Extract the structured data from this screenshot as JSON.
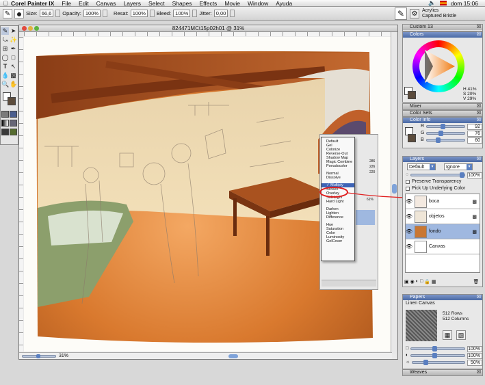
{
  "menubar": {
    "app_name": "Corel Painter IX",
    "items": [
      "File",
      "Edit",
      "Canvas",
      "Layers",
      "Select",
      "Shapes",
      "Effects",
      "Movie",
      "Window",
      "Ayuda"
    ],
    "clock": "dom 15:06"
  },
  "property_bar": {
    "size_label": "Size:",
    "size_value": "66,6",
    "opacity_label": "Opacity:",
    "opacity_value": "100%",
    "resat_label": "Resat:",
    "resat_value": "100%",
    "bleed_label": "Bleed:",
    "bleed_value": "100%",
    "jitter_label": "Jitter:",
    "jitter_value": "0,00",
    "brush_category": "Acrylics",
    "brush_variant": "Captured Bristle"
  },
  "document": {
    "title": "824471MCt15p02h01 @ 31%",
    "zoom": "31%"
  },
  "panels": {
    "custom_title": "Custom 13",
    "colors_title": "Colors",
    "hsv": [
      "H 41%",
      "S 20%",
      "V 29%"
    ],
    "mixer_title": "Mixer",
    "color_sets_title": "Color Sets",
    "color_info_title": "Color Info",
    "rgb": [
      {
        "label": "R",
        "value": "92",
        "fill": 0.36
      },
      {
        "label": "G",
        "value": "76",
        "fill": 0.3
      },
      {
        "label": "B",
        "value": "60",
        "fill": 0.24
      }
    ],
    "layers_title": "Layers",
    "composite_method": "Default",
    "composite_depth": "Ignore",
    "layer_opacity": "100%",
    "preserve_transparency": "Preserve Transparency",
    "pick_up_underlying": "Pick Up Underlying Color",
    "layer_names": [
      "boca",
      "objetos",
      "fondo",
      "Canvas"
    ],
    "papers_title": "Papers",
    "paper_name": "Linen Canvas",
    "paper_rows": "512 Rows",
    "paper_columns": "512 Columns",
    "paper_values": [
      "100%",
      "100%",
      "50%"
    ],
    "weaves_title": "Weaves"
  },
  "composite_menu": {
    "items": [
      "Default",
      "Gel",
      "Colorize",
      "Reverse-Out",
      "Shadow Map",
      "Magic Combine",
      "Pseudocolor",
      "",
      "Normal",
      "Dissolve",
      "",
      "Multiply",
      "Screen",
      "Overlay",
      "Soft Light",
      "Hard Light",
      "",
      "Darken",
      "Lighten",
      "Difference",
      "",
      "Hue",
      "Saturation",
      "Color",
      "Luminosity",
      "GelCover"
    ],
    "checked": "Multiply",
    "behind_values": [
      "286",
      "226",
      "220",
      "61%"
    ]
  },
  "colors": {
    "accent": "#4a6aa5",
    "annotation": "#e02020"
  }
}
